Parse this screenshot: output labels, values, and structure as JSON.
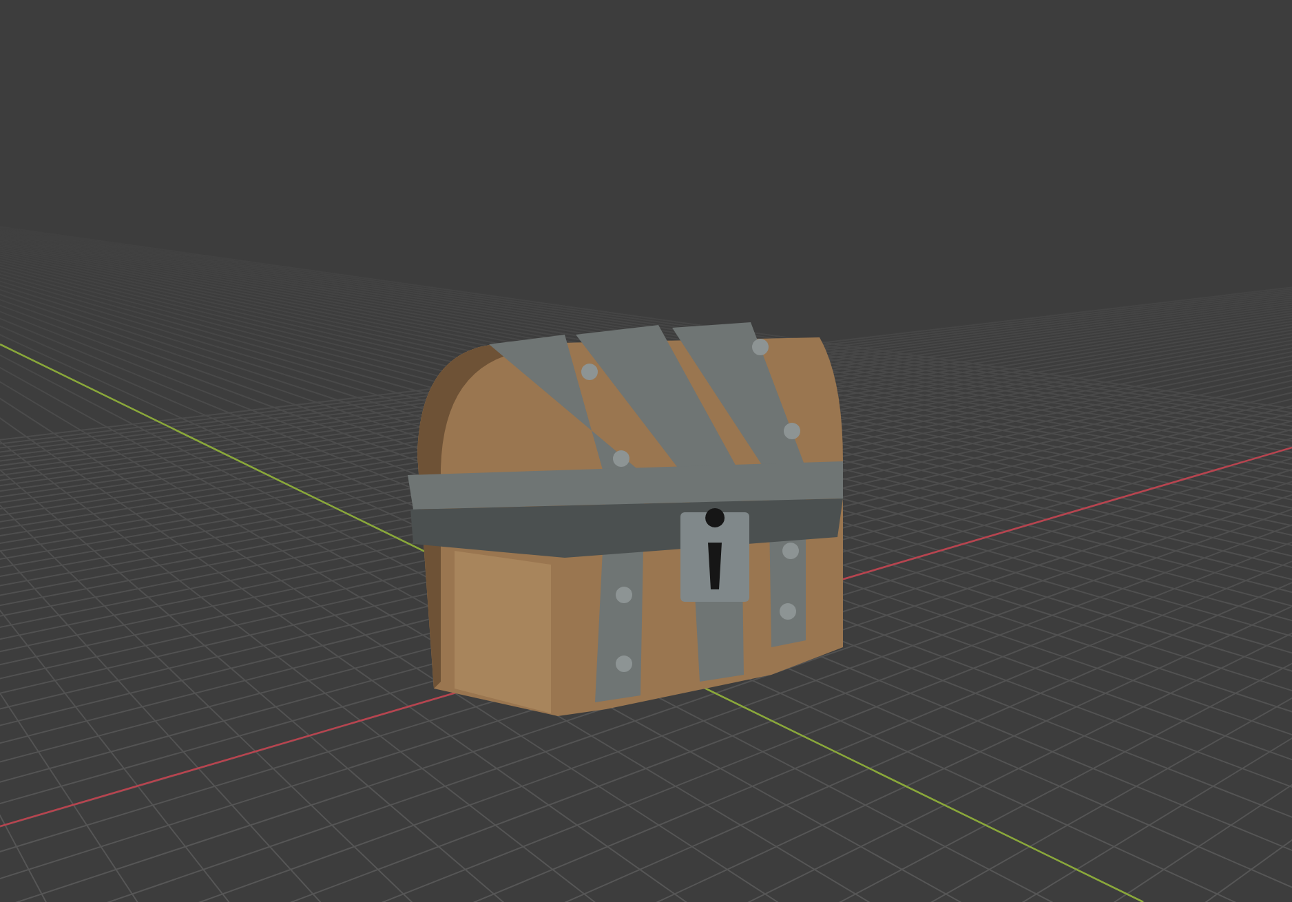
{
  "viewport": {
    "grid": true,
    "axes": true,
    "object": {
      "kind": "chest"
    }
  }
}
